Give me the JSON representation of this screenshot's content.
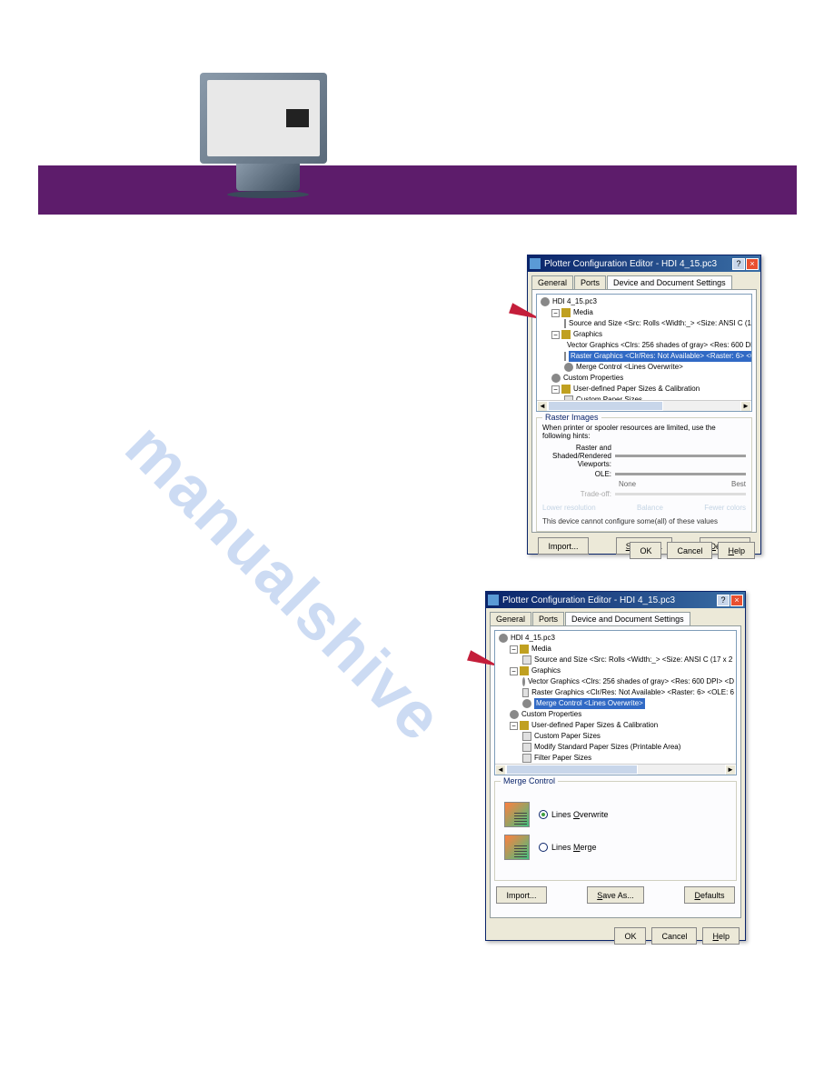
{
  "watermark": "manualshive",
  "dialog": {
    "title": "Plotter Configuration Editor - HDI 4_15.pc3",
    "tabs": {
      "general": "General",
      "ports": "Ports",
      "device": "Device and Document Settings"
    },
    "tree": {
      "root": "HDI 4_15.pc3",
      "media": "Media",
      "source": "Source and Size <Src:  Rolls <Width:_> <Size: ANSI C (17 x 2",
      "graphics": "Graphics",
      "vector": "Vector Graphics <Clrs: 256 shades of gray> <Res: 600 DPI> <D",
      "raster": "Raster Graphics <Clr/Res: Not Available> <Raster: 6> <OLE: 6",
      "merge": "Merge Control <Lines Overwrite>",
      "custom": "Custom Properties",
      "userdef": "User-defined Paper Sizes & Calibration",
      "customsizes": "Custom Paper Sizes",
      "modifysizes": "Modify Standard Paper Sizes (Printable Area)",
      "filter": "Filter Paper Sizes"
    },
    "raster_group": {
      "title": "Raster Images",
      "hint": "When printer or spooler resources are limited, use the following hints:",
      "slider1_label": "Raster and Shaded/Rendered Viewports:",
      "slider2_label": "OLE:",
      "slider3_label": "Trade-off:",
      "tick_none": "None",
      "tick_best": "Best",
      "bl_lower": "Lower resolution",
      "bl_balance": "Balance",
      "bl_fewer": "Fewer colors",
      "note": "This device cannot configure some(all) of these values"
    },
    "merge_group": {
      "title": "Merge Control",
      "overwrite": "Lines Overwrite",
      "merge": "Lines Merge"
    },
    "buttons": {
      "import": "Import...",
      "saveas": "Save As...",
      "defaults": "Defaults",
      "ok": "OK",
      "cancel": "Cancel",
      "help": "Help"
    }
  }
}
